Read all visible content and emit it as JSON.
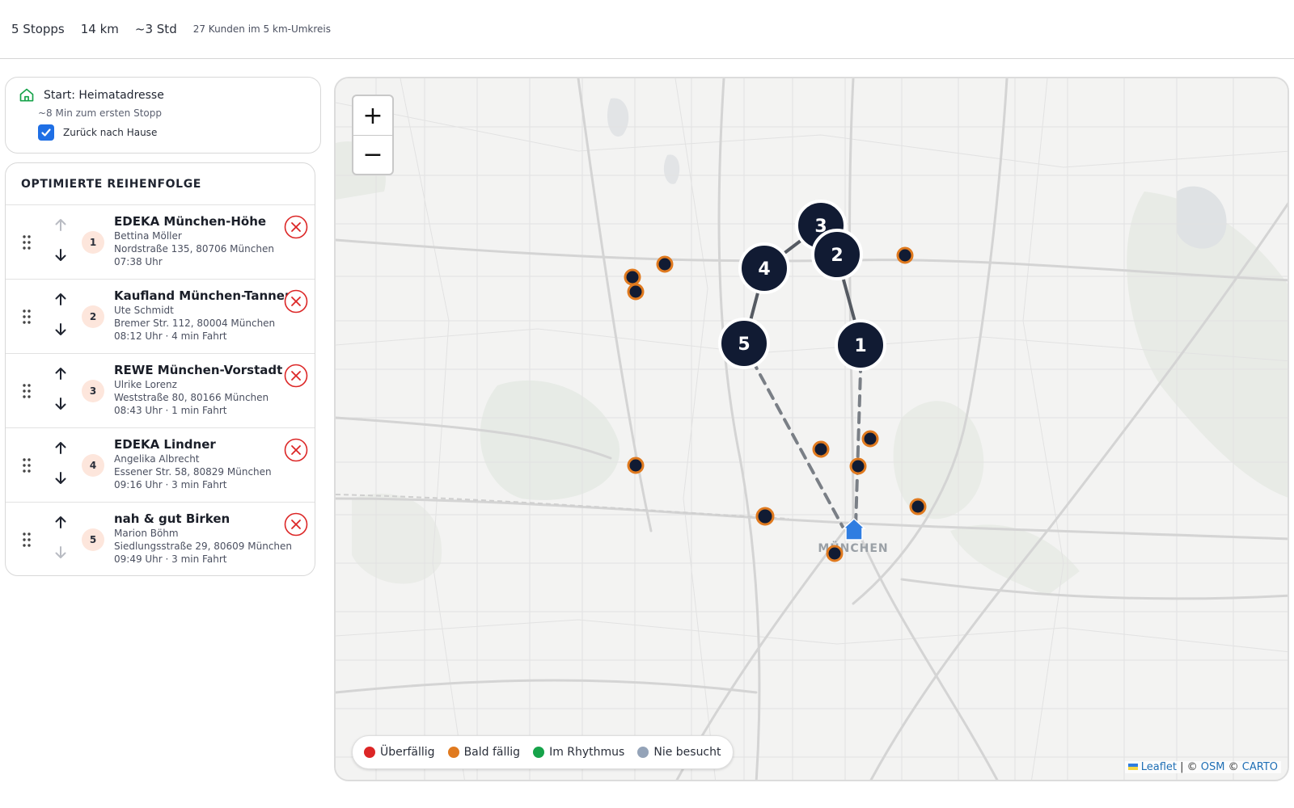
{
  "summary": {
    "stops": "5 Stopps",
    "distance": "14 km",
    "duration": "~3 Std",
    "customers_nearby": "27 Kunden im 5 km-Umkreis"
  },
  "start": {
    "label": "Start: Heimatadresse",
    "sub": "~8 Min zum ersten Stopp",
    "return_home_label": "Zurück nach Hause",
    "return_home_checked": true,
    "icon": "home-icon"
  },
  "route": {
    "title": "OPTIMIERTE REIHENFOLGE",
    "stops": [
      {
        "num": "1",
        "name": "EDEKA München-Höhe",
        "contact": "Bettina Möller",
        "address": "Nordstraße 135, 80706 München",
        "time": "07:38 Uhr",
        "up_enabled": false,
        "down_enabled": true
      },
      {
        "num": "2",
        "name": "Kaufland München-Tannen",
        "contact": "Ute Schmidt",
        "address": "Bremer Str. 112, 80004 München",
        "time": "08:12 Uhr  · 4 min Fahrt",
        "up_enabled": true,
        "down_enabled": true
      },
      {
        "num": "3",
        "name": "REWE München-Vorstadt",
        "contact": "Ulrike Lorenz",
        "address": "Weststraße 80, 80166 München",
        "time": "08:43 Uhr  · 1 min Fahrt",
        "up_enabled": true,
        "down_enabled": true
      },
      {
        "num": "4",
        "name": "EDEKA Lindner",
        "contact": "Angelika Albrecht",
        "address": "Essener Str. 58, 80829 München",
        "time": "09:16 Uhr  · 3 min Fahrt",
        "up_enabled": true,
        "down_enabled": true
      },
      {
        "num": "5",
        "name": "nah & gut Birken",
        "contact": "Marion Böhm",
        "address": "Siedlungsstraße 29, 80609 München",
        "time": "09:49 Uhr  · 3 min Fahrt",
        "up_enabled": true,
        "down_enabled": false
      }
    ]
  },
  "map": {
    "zoom_in": "+",
    "zoom_out": "−",
    "city_label": "MÜNCHEN",
    "marker_labels": [
      "1",
      "2",
      "3",
      "4",
      "5"
    ],
    "legend": [
      {
        "label": "Überfällig",
        "color": "#dc2626"
      },
      {
        "label": "Bald fällig",
        "color": "#e07a1f"
      },
      {
        "label": "Im Rhythmus",
        "color": "#16a34a"
      },
      {
        "label": "Nie besucht",
        "color": "#94a3b8"
      }
    ],
    "attribution": {
      "leaflet": "Leaflet",
      "sep1": " | © ",
      "osm": "OSM",
      "sep2": " © ",
      "carto": "CARTO"
    },
    "colors": {
      "stop_marker": "#111b33",
      "customer_ring": "#e07a1f",
      "route_line": "#555a62",
      "home": "#2f7de1"
    }
  }
}
